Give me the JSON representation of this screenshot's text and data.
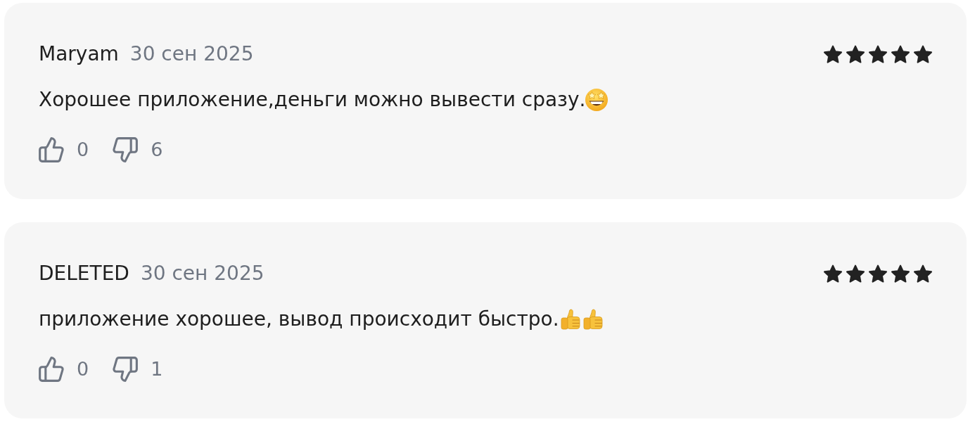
{
  "reviews": [
    {
      "author": "Maryam",
      "date": "30 сен 2025",
      "stars": 5,
      "text": "Хорошее приложение,деньги можно вывести сразу.",
      "emojis": [
        {
          "kind": "star-struck"
        }
      ],
      "likes": "0",
      "dislikes": "6"
    },
    {
      "author": "DELETED",
      "date": "30 сен 2025",
      "stars": 5,
      "text": "приложение хорошее, вывод происходит быстро.",
      "emojis": [
        {
          "kind": "thumbs-up"
        },
        {
          "kind": "thumbs-up"
        }
      ],
      "likes": "0",
      "dislikes": "1"
    }
  ]
}
